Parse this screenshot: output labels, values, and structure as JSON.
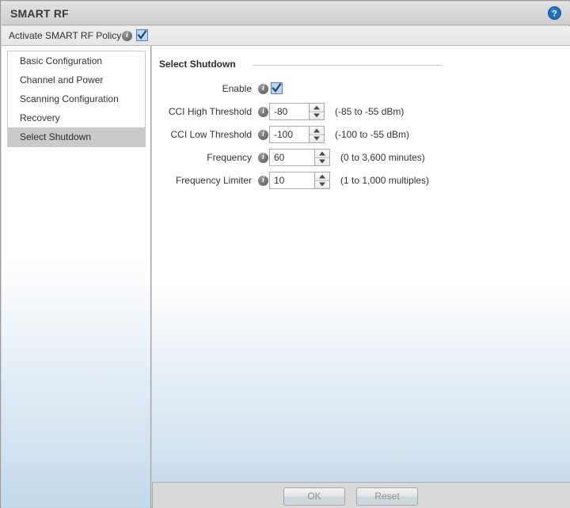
{
  "window": {
    "title": "SMART RF",
    "help_icon": "help-circle-icon"
  },
  "activate": {
    "label": "Activate SMART RF Policy",
    "info_icon": "info-icon",
    "checked": true
  },
  "sidebar": {
    "items": [
      {
        "label": "Basic Configuration",
        "selected": false
      },
      {
        "label": "Channel and Power",
        "selected": false
      },
      {
        "label": "Scanning Configuration",
        "selected": false
      },
      {
        "label": "Recovery",
        "selected": false
      },
      {
        "label": "Select Shutdown",
        "selected": true
      }
    ]
  },
  "main": {
    "section_title": "Select Shutdown",
    "rows": [
      {
        "label": "Enable",
        "control": "checkbox",
        "value": "",
        "checked": true,
        "hint": "",
        "info_icon": "info-icon"
      },
      {
        "label": "CCI High Threshold",
        "control": "spinner",
        "value": "-80",
        "hint": "(-85 to -55 dBm)",
        "info_icon": "info-icon"
      },
      {
        "label": "CCI Low  Threshold",
        "control": "spinner",
        "value": "-100",
        "hint": "(-100 to -55 dBm)",
        "info_icon": "info-icon"
      },
      {
        "label": "Frequency",
        "control": "spinner",
        "value": "60",
        "hint": "(0 to 3,600 minutes)",
        "info_icon": "info-icon"
      },
      {
        "label": "Frequency Limiter",
        "control": "spinner",
        "value": "10",
        "hint": "(1 to 1,000 multiples)",
        "info_icon": "info-icon"
      }
    ]
  },
  "buttons": {
    "ok_label": "OK",
    "reset_label": "Reset"
  },
  "colors": {
    "accent_blue": "#1f6fc4",
    "selected_row": "#c9c9c9",
    "panel_gradient_bottom": "#c2d8ea",
    "disabled_text": "#8e8e8e"
  }
}
